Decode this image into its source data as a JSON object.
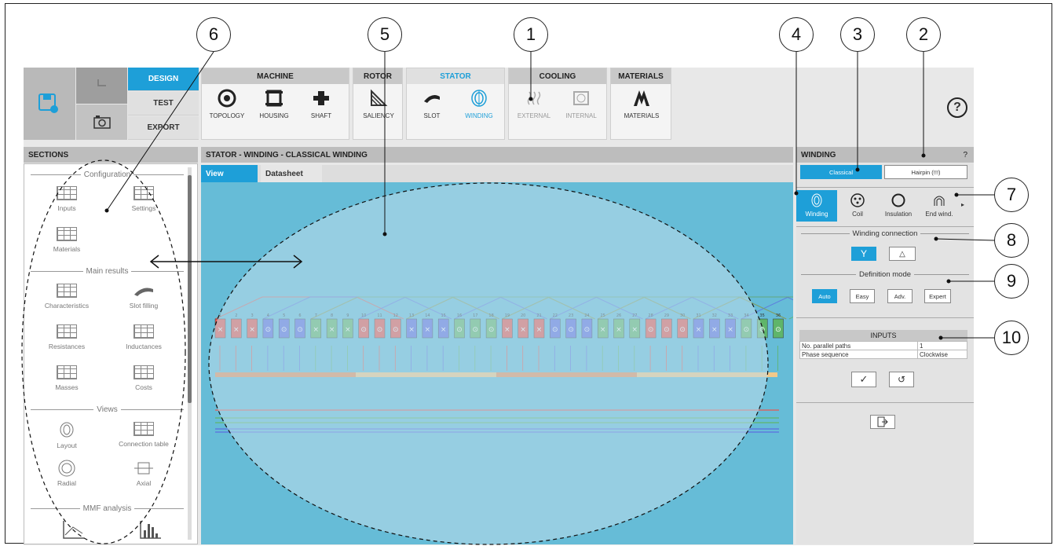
{
  "menu": {
    "design": "DESIGN",
    "test": "TEST",
    "export": "EXPORT"
  },
  "ribbon": {
    "machine": {
      "title": "MACHINE",
      "tools": [
        "TOPOLOGY",
        "HOUSING",
        "SHAFT"
      ]
    },
    "rotor": {
      "title": "ROTOR",
      "tools": [
        "SALIENCY"
      ]
    },
    "stator": {
      "title": "STATOR",
      "tools": [
        "SLOT",
        "WINDING"
      ]
    },
    "cooling": {
      "title": "COOLING",
      "tools": [
        "EXTERNAL",
        "INTERNAL"
      ]
    },
    "materials": {
      "title": "MATERIALS",
      "tools": [
        "MATERIALS"
      ]
    },
    "help": "?"
  },
  "sections": {
    "title": "SECTIONS",
    "configuration": "Configuration",
    "inputs": "Inputs",
    "settings": "Settings",
    "materials": "Materials",
    "main_results": "Main results",
    "characteristics": "Characteristics",
    "slot_filling": "Slot filling",
    "resistances": "Resistances",
    "inductances": "Inductances",
    "masses": "Masses",
    "costs": "Costs",
    "views": "Views",
    "layout": "Layout",
    "connection_table": "Connection table",
    "radial": "Radial",
    "axial": "Axial",
    "mmf_analysis": "MMF analysis"
  },
  "center": {
    "title": "STATOR - WINDING - CLASSICAL WINDING",
    "tab_view": "View",
    "tab_datasheet": "Datasheet"
  },
  "winding": {
    "title": "WINDING",
    "help": "?",
    "classical": "Classical",
    "hairpin": "Hairpin (!!!)",
    "subtabs": [
      "Winding",
      "Coil",
      "Insulation",
      "End wind."
    ],
    "connection_label": "Winding connection",
    "conn_y": "Y",
    "conn_delta": "△",
    "definition_label": "Definition mode",
    "modes": [
      "Auto",
      "Easy",
      "Adv.",
      "Expert"
    ],
    "inputs_title": "INPUTS",
    "inputs": [
      {
        "name": "No. parallel paths",
        "value": "1"
      },
      {
        "name": "Phase sequence",
        "value": "Clockwise"
      }
    ],
    "confirm": "✓",
    "reset": "↺"
  },
  "slots": {
    "count": 36,
    "pattern": [
      "R",
      "R",
      "R",
      "B",
      "B",
      "B",
      "G",
      "G",
      "G",
      "R",
      "R",
      "R",
      "B",
      "B",
      "B",
      "G",
      "G",
      "G",
      "R",
      "R",
      "R",
      "B",
      "B",
      "B",
      "G",
      "G",
      "G",
      "R",
      "R",
      "R",
      "B",
      "B",
      "B",
      "G",
      "G",
      "G"
    ],
    "marks": [
      "x",
      "x",
      "x",
      "o",
      "o",
      "o",
      "x",
      "x",
      "x",
      "o",
      "o",
      "o",
      "x",
      "x",
      "x",
      "o",
      "o",
      "o",
      "x",
      "x",
      "x",
      "o",
      "o",
      "o",
      "x",
      "x",
      "x",
      "o",
      "o",
      "o",
      "x",
      "x",
      "x",
      "o",
      "o",
      "o"
    ]
  },
  "colors": {
    "accent": "#1e9fd8",
    "red": "#e8574f",
    "blue": "#5b6ee0",
    "green": "#5fb56a",
    "orange": "#e8915a",
    "sand": "#f2c98a"
  },
  "callouts": [
    "1",
    "2",
    "3",
    "4",
    "5",
    "6",
    "7",
    "8",
    "9",
    "10"
  ]
}
